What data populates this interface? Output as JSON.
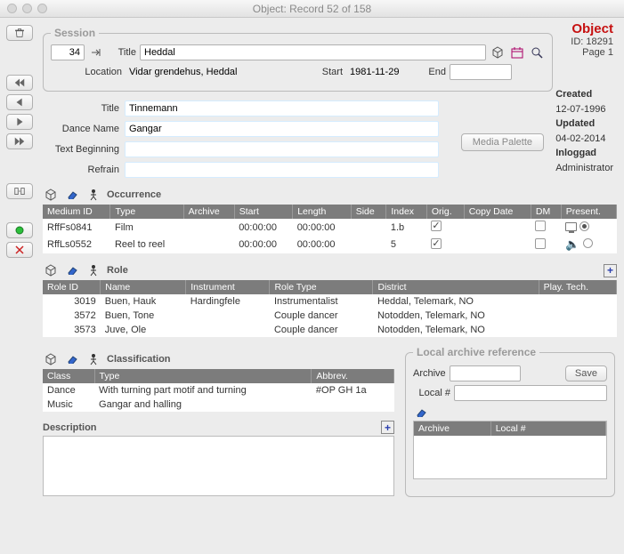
{
  "window": {
    "title": "Object: Record 52 of 158"
  },
  "toolbar": {
    "trash": "trash",
    "nav_first": "first",
    "nav_prev": "prev",
    "nav_next": "next",
    "nav_last": "last",
    "expand": "expand",
    "green": "green",
    "delete": "delete"
  },
  "object_header": {
    "title": "Object",
    "id_label": "ID:",
    "id_value": "18291",
    "page_label": "Page",
    "page_value": "1"
  },
  "meta": {
    "created_label": "Created",
    "created_value": "12-07-1996",
    "updated_label": "Updated",
    "updated_value": "04-02-2014",
    "inloggad_label": "Inloggad",
    "inloggad_value": "Administrator"
  },
  "session": {
    "legend": "Session",
    "number": "34",
    "title_label": "Title",
    "title_value": "Heddal",
    "location_label": "Location",
    "location_value": "Vidar grendehus, Heddal",
    "start_label": "Start",
    "start_value": "1981-11-29",
    "end_label": "End",
    "end_value": ""
  },
  "form": {
    "title_label": "Title",
    "title_value": "Tinnemann",
    "dance_name_label": "Dance Name",
    "dance_name_value": "Gangar",
    "text_beginning_label": "Text Beginning",
    "text_beginning_value": "",
    "refrain_label": "Refrain",
    "refrain_value": ""
  },
  "media_palette_label": "Media Palette",
  "occurrence": {
    "legend": "Occurrence",
    "columns": [
      "Medium ID",
      "Type",
      "Archive",
      "Start",
      "Length",
      "Side",
      "Index",
      "Orig.",
      "Copy Date",
      "DM",
      "Present."
    ],
    "rows": [
      {
        "medium_id": "RffFs0841",
        "type": "Film",
        "archive": "",
        "start": "00:00:00",
        "length": "00:00:00",
        "side": "",
        "index": "1.b",
        "orig": true,
        "copy_date": "",
        "dm": false,
        "present_icon": "monitor",
        "present_radio": true
      },
      {
        "medium_id": "RffLs0552",
        "type": "Reel to reel",
        "archive": "",
        "start": "00:00:00",
        "length": "00:00:00",
        "side": "",
        "index": "5",
        "orig": true,
        "copy_date": "",
        "dm": false,
        "present_icon": "speaker",
        "present_radio": false
      }
    ]
  },
  "role": {
    "legend": "Role",
    "columns": [
      "Role ID",
      "Name",
      "Instrument",
      "Role Type",
      "District",
      "Play. Tech."
    ],
    "rows": [
      {
        "role_id": "3019",
        "name": "Buen, Hauk",
        "instrument": "Hardingfele",
        "role_type": "Instrumentalist",
        "district": "Heddal, Telemark, NO",
        "play_tech": ""
      },
      {
        "role_id": "3572",
        "name": "Buen, Tone",
        "instrument": "",
        "role_type": "Couple dancer",
        "district": "Notodden, Telemark, NO",
        "play_tech": ""
      },
      {
        "role_id": "3573",
        "name": "Juve, Ole",
        "instrument": "",
        "role_type": "Couple dancer",
        "district": "Notodden, Telemark, NO",
        "play_tech": ""
      }
    ]
  },
  "classification": {
    "legend": "Classification",
    "columns": [
      "Class",
      "Type",
      "Abbrev."
    ],
    "rows": [
      {
        "class": "Dance",
        "type": "With turning part motif and turning",
        "abbrev": "#OP GH 1a"
      },
      {
        "class": "Music",
        "type": "Gangar and halling",
        "abbrev": ""
      }
    ]
  },
  "description": {
    "legend": "Description",
    "value": ""
  },
  "localref": {
    "legend": "Local archive reference",
    "archive_label": "Archive",
    "archive_value": "",
    "local_label": "Local #",
    "local_value": "",
    "save_label": "Save",
    "table_columns": [
      "Archive",
      "Local #"
    ]
  }
}
